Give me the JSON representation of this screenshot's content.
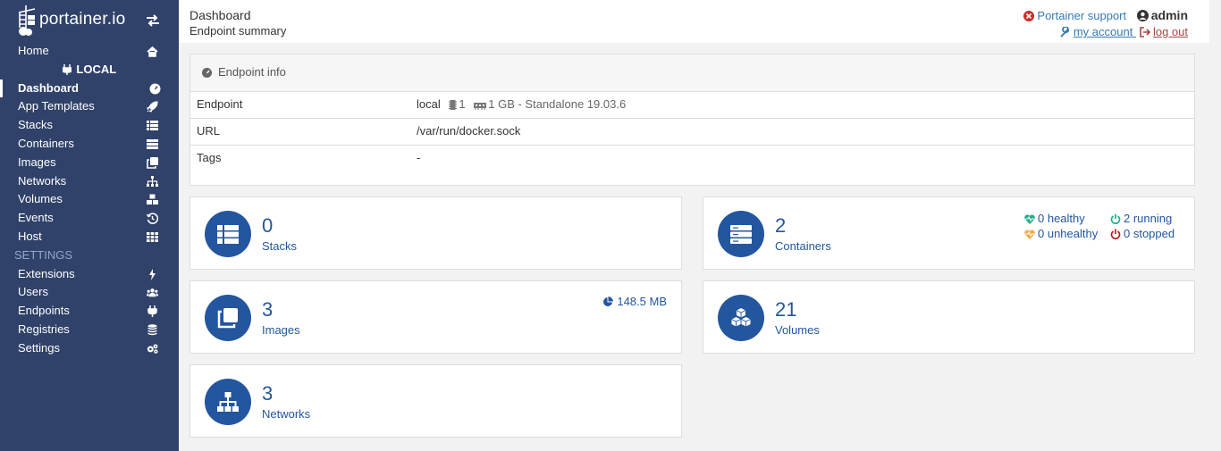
{
  "brand": {
    "name": "portainer.io"
  },
  "sidebar": {
    "items": [
      {
        "label": "Home",
        "icon": "home-icon"
      },
      {
        "label": "LOCAL",
        "icon": "plug-icon"
      },
      {
        "label": "Dashboard",
        "icon": "tachometer-icon"
      },
      {
        "label": "App Templates",
        "icon": "rocket-icon"
      },
      {
        "label": "Stacks",
        "icon": "th-list-icon"
      },
      {
        "label": "Containers",
        "icon": "server-icon"
      },
      {
        "label": "Images",
        "icon": "clone-icon"
      },
      {
        "label": "Networks",
        "icon": "sitemap-icon"
      },
      {
        "label": "Volumes",
        "icon": "cubes-icon"
      },
      {
        "label": "Events",
        "icon": "history-icon"
      },
      {
        "label": "Host",
        "icon": "th-icon"
      },
      {
        "label": "SETTINGS"
      },
      {
        "label": "Extensions",
        "icon": "bolt-icon"
      },
      {
        "label": "Users",
        "icon": "users-icon"
      },
      {
        "label": "Endpoints",
        "icon": "plug-icon"
      },
      {
        "label": "Registries",
        "icon": "database-icon"
      },
      {
        "label": "Settings",
        "icon": "cogs-icon"
      }
    ]
  },
  "header": {
    "title": "Dashboard",
    "subtitle": "Endpoint summary",
    "support": "Portainer support",
    "user": "admin",
    "my_account": "my account",
    "log_out": "log out"
  },
  "endpoint_info": {
    "title": "Endpoint info",
    "rows": [
      {
        "key": "Endpoint",
        "name": "local",
        "cpu": "1",
        "memory": "1 GB - Standalone 19.03.6"
      },
      {
        "key": "URL",
        "value": "/var/run/docker.sock"
      },
      {
        "key": "Tags",
        "value": "-"
      }
    ]
  },
  "widgets": {
    "stacks": {
      "count": "0",
      "label": "Stacks"
    },
    "containers": {
      "count": "2",
      "label": "Containers",
      "healthy": "0 healthy",
      "running": "2 running",
      "unhealthy": "0 unhealthy",
      "stopped": "0 stopped"
    },
    "images": {
      "count": "3",
      "label": "Images",
      "size": "148.5 MB"
    },
    "volumes": {
      "count": "21",
      "label": "Volumes"
    },
    "networks": {
      "count": "3",
      "label": "Networks"
    }
  },
  "colors": {
    "sidebar": "#30426a",
    "accent": "#23569e",
    "link": "#337ab7",
    "danger": "#a94442",
    "healthy": "#23ae89",
    "unhealthy": "#f0ad4e",
    "running": "#23ae89",
    "stopped": "#ae2323"
  }
}
